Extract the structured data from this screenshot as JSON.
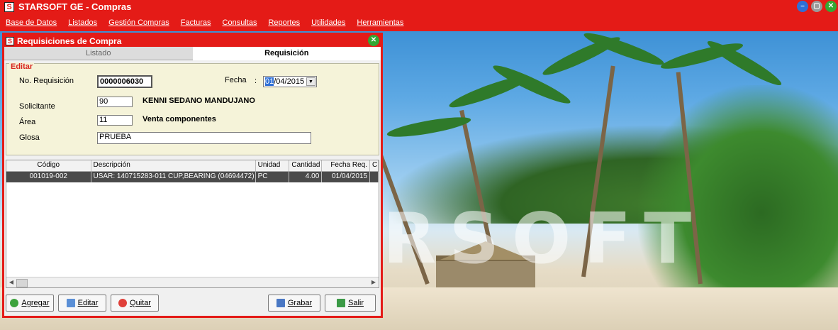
{
  "app": {
    "title": "STARSOFT GE - Compras"
  },
  "menu": [
    {
      "label": "Base de Datos"
    },
    {
      "label": "Listados"
    },
    {
      "label": "Gestión Compras"
    },
    {
      "label": "Facturas"
    },
    {
      "label": "Consultas"
    },
    {
      "label": "Reportes"
    },
    {
      "label": "Utilidades"
    },
    {
      "label": "Herramientas"
    }
  ],
  "window": {
    "title": "Requisiciones de Compra",
    "tabs": [
      {
        "label": "Listado"
      },
      {
        "label": "Requisición"
      }
    ]
  },
  "form": {
    "legend": "Editar",
    "no_req_label": "No. Requisición",
    "no_req_value": "0000006030",
    "fecha_label": "Fecha",
    "fecha_sep": ":",
    "fecha_day": "01",
    "fecha_rest": "/04/2015",
    "solicitante_label": "Solicitante",
    "solicitante_code": "90",
    "solicitante_name": "KENNI SEDANO MANDUJANO",
    "area_label": "Área",
    "area_code": "11",
    "area_name": "Venta componentes",
    "glosa_label": "Glosa",
    "glosa_value": "PRUEBA"
  },
  "grid": {
    "headers": [
      "Código",
      "Descripción",
      "Unidad",
      "Cantidad",
      "Fecha Req.",
      "C"
    ],
    "rows": [
      [
        "001019-002",
        "USAR: 140715283-011 CUP,BEARING (04694472)",
        "PC",
        "4.00",
        "01/04/2015",
        ""
      ]
    ]
  },
  "buttons": {
    "agregar": "Agregar",
    "editar": "Editar",
    "quitar": "Quitar",
    "grabar": "Grabar",
    "salir": "Salir"
  },
  "background": {
    "watermark": "RSOFT"
  },
  "colors": {
    "brand_red": "#e41b17",
    "form_bg": "#f5f3d9",
    "selected_row": "#4a4a4a"
  }
}
